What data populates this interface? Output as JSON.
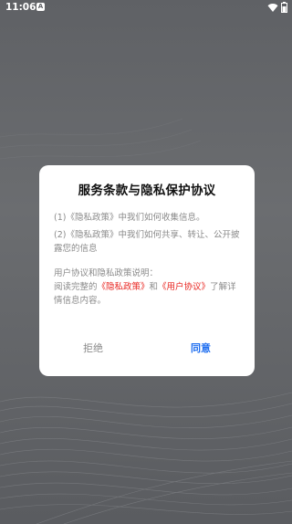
{
  "status_bar": {
    "time": "11:06",
    "notification_badge": "A",
    "icons": [
      "wifi-icon",
      "battery-icon"
    ]
  },
  "dialog": {
    "title": "服务条款与隐私保护协议",
    "items": [
      {
        "number": "(1)",
        "link_text": "《隐私政策》",
        "text": "中我们如何收集信息。"
      },
      {
        "number": "(2)",
        "link_text": "《隐私政策》",
        "text": "中我们如何共享、转让、公开披露您的信息"
      }
    ],
    "note_heading": "用户协议和隐私政策说明：",
    "note_prefix": "阅读完整的",
    "privacy_link": "《隐私政策》",
    "note_and": "和",
    "user_agreement_link": "《用户协议》",
    "note_suffix": "了解详情信息内容。",
    "refuse_label": "拒绝",
    "agree_label": "同意"
  },
  "colors": {
    "background": "#646669",
    "dialog_bg": "#ffffff",
    "link_red": "#e8241f",
    "agree_blue": "#1e6ef0",
    "muted_text": "#8a8a8a"
  }
}
